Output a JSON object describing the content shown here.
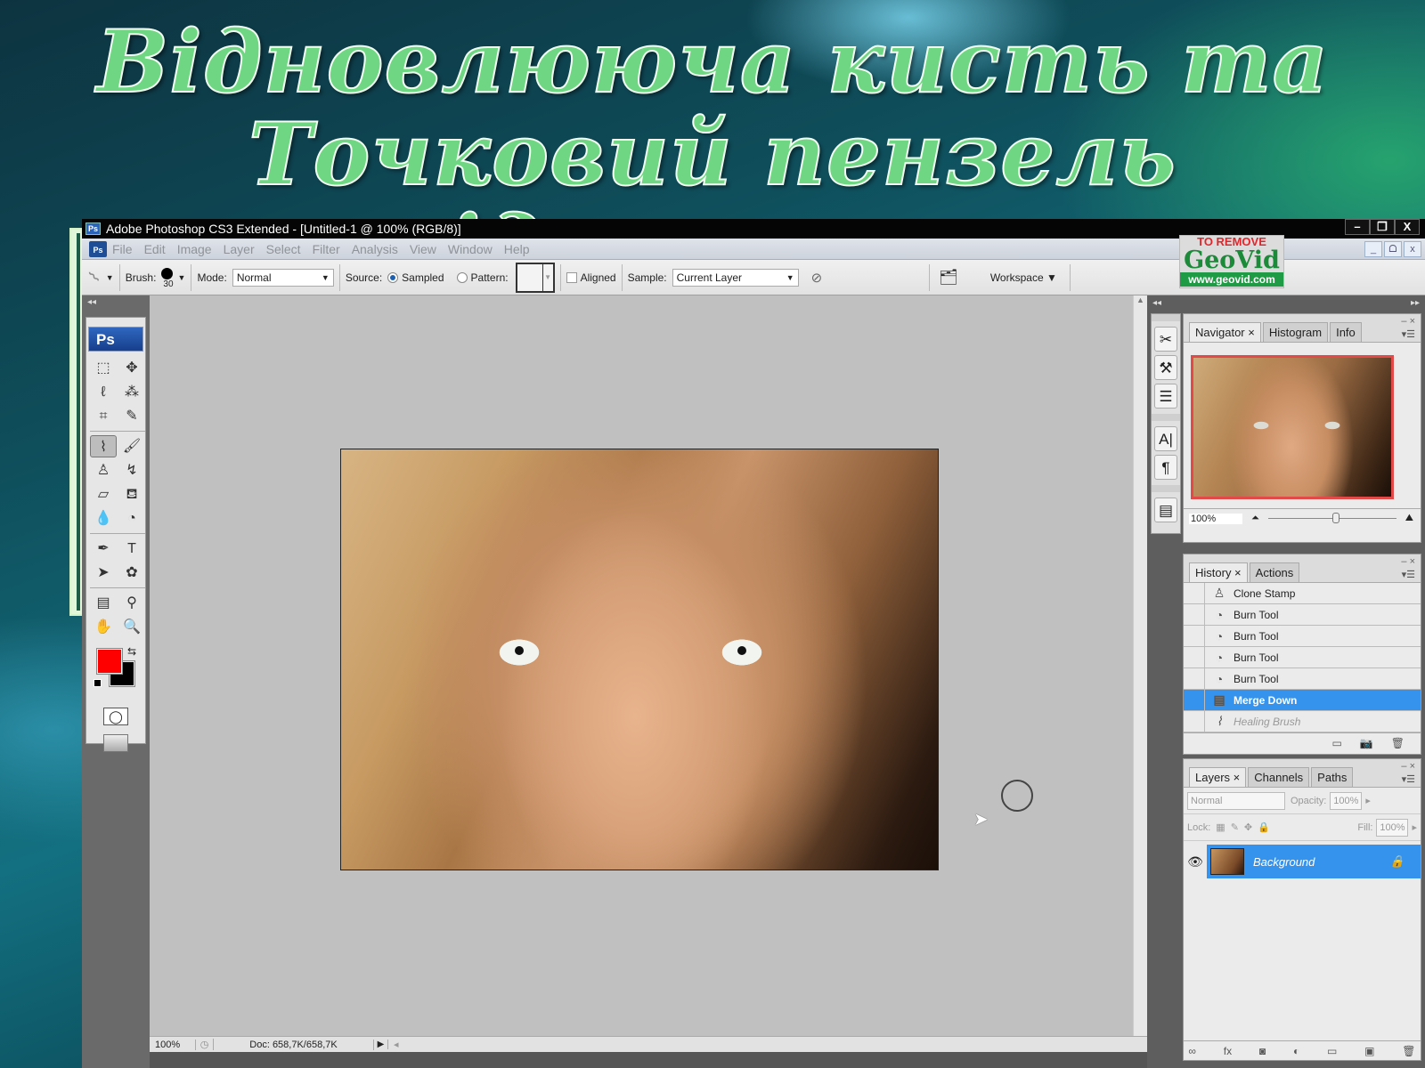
{
  "slide": {
    "title_line1": "Відновлююча кисть та",
    "title_line2": "Точковий пензель відновлення"
  },
  "window": {
    "app_badge": "Ps",
    "title": "Adobe Photoshop CS3 Extended - [Untitled-1 @ 100% (RGB/8)]",
    "minimize": "–",
    "restore": "❐",
    "close": "X"
  },
  "menu": {
    "logo": "Ps",
    "items": [
      "File",
      "Edit",
      "Image",
      "Layer",
      "Select",
      "Filter",
      "Analysis",
      "View",
      "Window",
      "Help"
    ],
    "doc_minimize": "_",
    "doc_restore": "ᗝ",
    "doc_close": "x"
  },
  "options": {
    "tool_icon": "healing-brush",
    "brush_label": "Brush:",
    "brush_size": "30",
    "mode_label": "Mode:",
    "mode_value": "Normal",
    "source_label": "Source:",
    "source_sampled": "Sampled",
    "source_pattern": "Pattern:",
    "source_selected": "Sampled",
    "aligned_label": "Aligned",
    "aligned_checked": false,
    "sample_label": "Sample:",
    "sample_value": "Current Layer",
    "workspace_label": "Workspace ▼"
  },
  "watermark": {
    "line1": "TO REMOVE",
    "line2": "GeoVid",
    "line3": "www.geovid.com"
  },
  "toolbox": {
    "header": "Ps",
    "collapse": "◂◂",
    "tools": [
      {
        "name": "marquee",
        "glyph": "⬚"
      },
      {
        "name": "move",
        "glyph": "✥"
      },
      {
        "name": "lasso",
        "glyph": "ℓ"
      },
      {
        "name": "magic-wand",
        "glyph": "⁂"
      },
      {
        "name": "crop",
        "glyph": "⌗"
      },
      {
        "name": "slice",
        "glyph": "✎"
      },
      {
        "name": "healing-brush",
        "glyph": "⌇",
        "active": true
      },
      {
        "name": "brush",
        "glyph": "🖌"
      },
      {
        "name": "clone-stamp",
        "glyph": "♙"
      },
      {
        "name": "history-brush",
        "glyph": "↯"
      },
      {
        "name": "eraser",
        "glyph": "▱"
      },
      {
        "name": "paint-bucket",
        "glyph": "⛾"
      },
      {
        "name": "blur",
        "glyph": "💧"
      },
      {
        "name": "dodge",
        "glyph": "◔"
      },
      {
        "name": "pen",
        "glyph": "✒"
      },
      {
        "name": "type",
        "glyph": "T"
      },
      {
        "name": "path-selection",
        "glyph": "➤"
      },
      {
        "name": "custom-shape",
        "glyph": "✿"
      },
      {
        "name": "notes",
        "glyph": "▤"
      },
      {
        "name": "eyedropper",
        "glyph": "⚲"
      },
      {
        "name": "hand",
        "glyph": "✋"
      },
      {
        "name": "zoom",
        "glyph": "🔍"
      }
    ],
    "foreground_color": "#ff0000",
    "background_color": "#000000",
    "swap_glyph": "⇆",
    "quickmask_glyph": "◯"
  },
  "status": {
    "zoom": "100%",
    "doc": "Doc: 658,7K/658,7K",
    "menu_arrow": "▶",
    "hscroll_arrow": "◂"
  },
  "dock": {
    "collapse": "◂◂",
    "expand": "▸▸",
    "strip_icons": [
      "tool-presets",
      "brushes",
      "clone-source",
      "character",
      "paragraph",
      "layer-comps"
    ],
    "strip_glyphs": [
      "✂",
      "⚒",
      "☰",
      "A|",
      "¶",
      "▤"
    ]
  },
  "navigator": {
    "tabs": [
      "Navigator ×",
      "Histogram",
      "Info"
    ],
    "active_tab": "Navigator",
    "zoom": "100%",
    "zoom_slider_fraction": 0.5
  },
  "history": {
    "tabs": [
      "History ×",
      "Actions"
    ],
    "active_tab": "History",
    "items": [
      {
        "label": "Clone Stamp",
        "icon": "clone-stamp",
        "glyph": "♙",
        "state": "normal"
      },
      {
        "label": "Burn Tool",
        "icon": "burn",
        "glyph": "◔",
        "state": "normal"
      },
      {
        "label": "Burn Tool",
        "icon": "burn",
        "glyph": "◔",
        "state": "normal"
      },
      {
        "label": "Burn Tool",
        "icon": "burn",
        "glyph": "◔",
        "state": "normal"
      },
      {
        "label": "Burn Tool",
        "icon": "burn",
        "glyph": "◔",
        "state": "normal"
      },
      {
        "label": "Merge Down",
        "icon": "merge",
        "glyph": "▤",
        "state": "active"
      },
      {
        "label": "Healing Brush",
        "icon": "healing-brush",
        "glyph": "⌇",
        "state": "future"
      }
    ],
    "footer_icons": [
      "new-document-from-state",
      "create-snapshot",
      "delete-state"
    ],
    "footer_glyphs": [
      "▭",
      "📷",
      "🗑"
    ]
  },
  "layers": {
    "tabs": [
      "Layers ×",
      "Channels",
      "Paths"
    ],
    "active_tab": "Layers",
    "blend_mode": "Normal",
    "opacity_label": "Opacity:",
    "opacity": "100%",
    "lock_label": "Lock:",
    "fill_label": "Fill:",
    "fill": "100%",
    "items": [
      {
        "name": "Background",
        "visible": true,
        "locked": true,
        "selected": true
      }
    ],
    "footer_icons": [
      "link-layers",
      "fx",
      "add-mask",
      "adjustment-layer",
      "new-group",
      "new-layer",
      "delete-layer"
    ],
    "footer_glyphs": [
      "∞",
      "fx",
      "◙",
      "◐",
      "▭",
      "▣",
      "🗑"
    ]
  }
}
